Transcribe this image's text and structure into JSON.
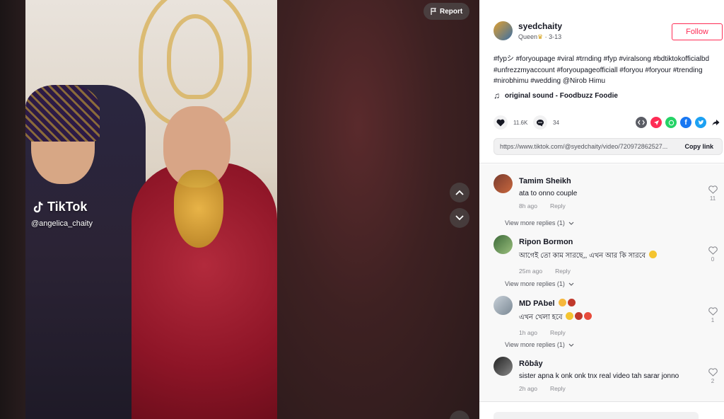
{
  "video": {
    "watermark_logo": "TikTok",
    "watermark_handle": "@angelica_chaity",
    "report_label": "Report"
  },
  "author": {
    "username": "syedchaity",
    "nickname": "Queen",
    "date": "3-13",
    "follow_label": "Follow"
  },
  "description": "#fypシ #foryoupage #viral #trnding #fyp #viralsong #bdtiktokofficialbd #unfrezzmyaccount #foryoupageofficiall #foryou #foryour #trending #nirobhimu #wedding @Nirob Himu",
  "sound": "original sound - Foodbuzz Foodie",
  "stats": {
    "likes": "11.6K",
    "comments": "34"
  },
  "link": {
    "url": "https://www.tiktok.com/@syedchaity/video/720972862527...",
    "copy_label": "Copy link"
  },
  "colors": {
    "accent": "#fe2c55",
    "whatsapp": "#25d366",
    "facebook": "#1877f2",
    "twitter": "#1da1f2",
    "embed": "#5b5d65"
  },
  "comments": [
    {
      "name": "Tamim Sheikh",
      "text": "ata to onno couple",
      "time": "8h ago",
      "reply": "Reply",
      "likes": "11",
      "view_replies": "View more replies (1)"
    },
    {
      "name": "Ripon Bormon",
      "text": "আগেই তো কাম সারছে,, এখন আর কি সারবে",
      "time": "25m ago",
      "reply": "Reply",
      "likes": "0",
      "view_replies": "View more replies (1)"
    },
    {
      "name": "MD PAbel",
      "text": "এখন খেলা হবে",
      "time": "1h ago",
      "reply": "Reply",
      "likes": "1",
      "view_replies": "View more replies (1)"
    },
    {
      "name": "Rôbây",
      "text": "sister apna k onk onk tnx real video tah sarar jonno",
      "time": "2h ago",
      "reply": "Reply",
      "likes": "2"
    }
  ]
}
